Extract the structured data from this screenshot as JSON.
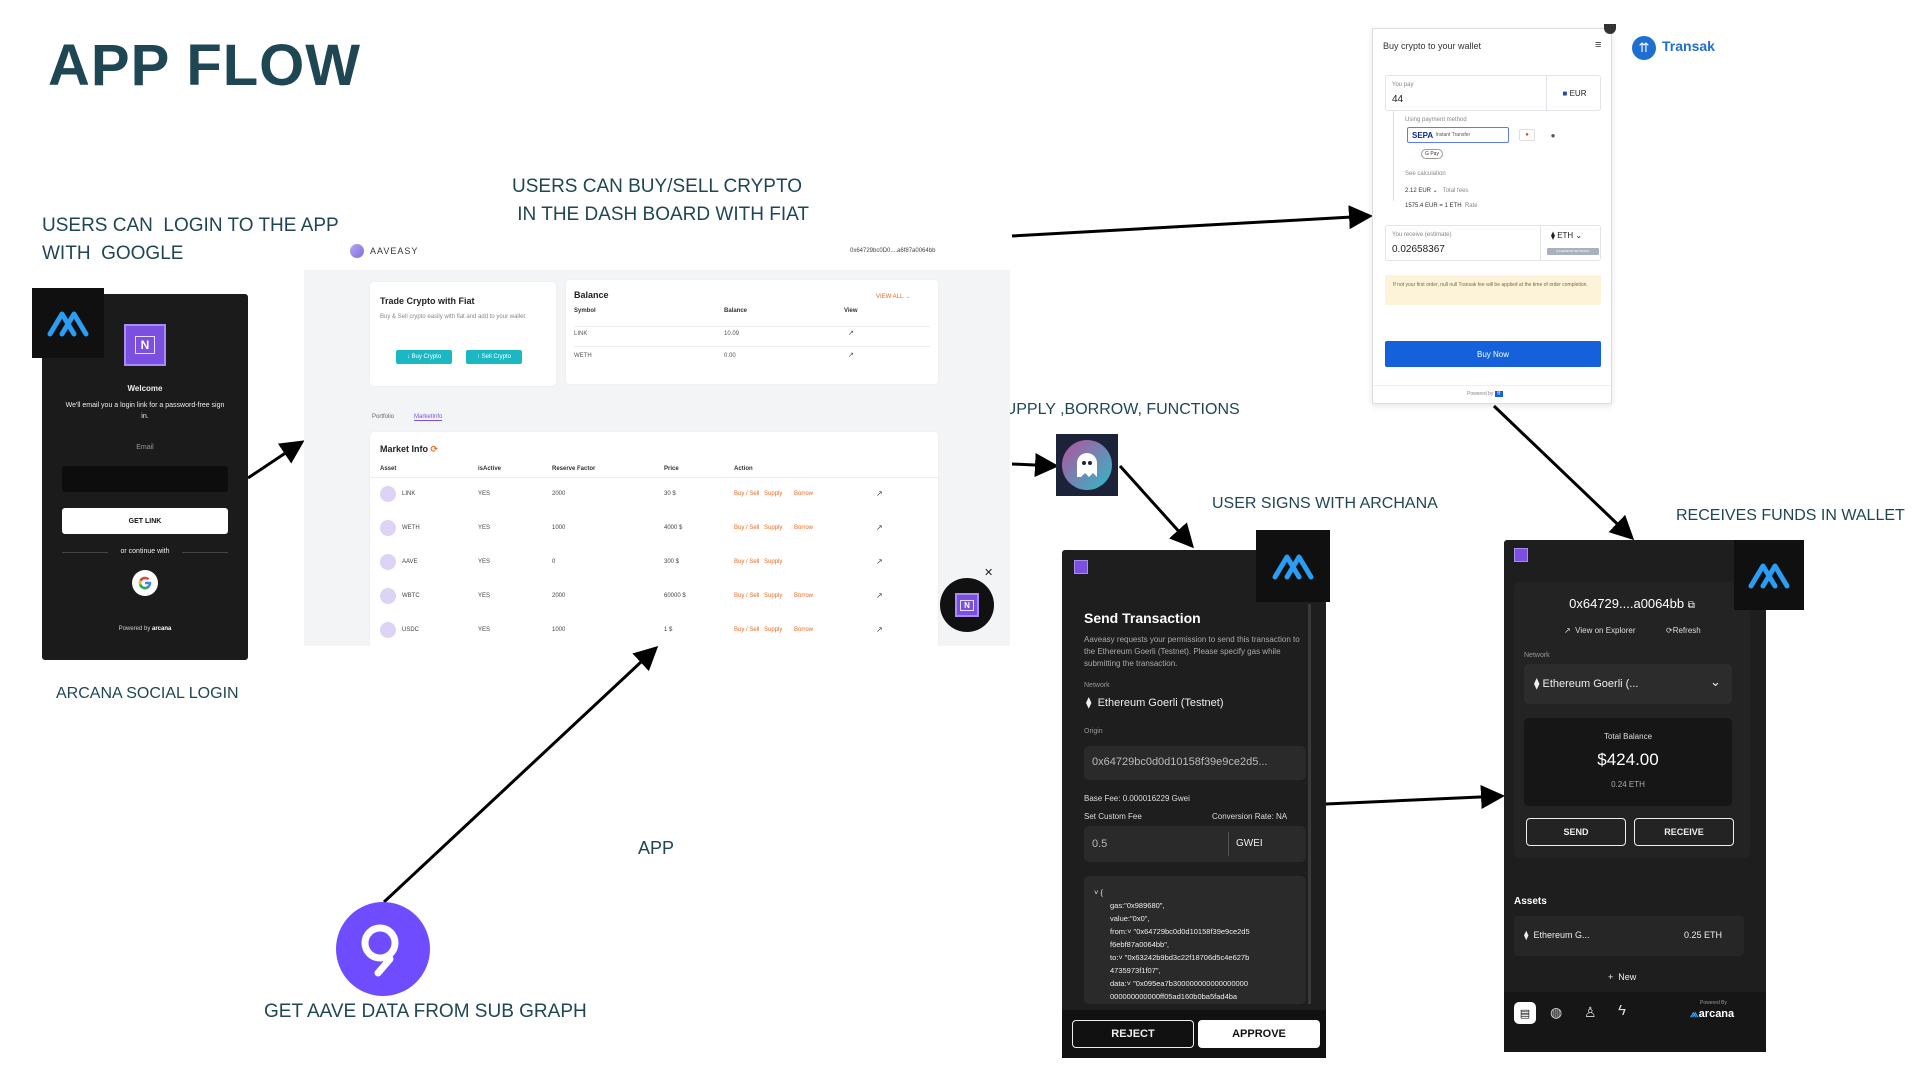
{
  "title": "APP FLOW",
  "labels": {
    "login": "USERS CAN  LOGIN TO THE APP\nWITH  GOOGLE",
    "buy_sell": "USERS CAN BUY/SELL CRYPTO\n IN THE DASH BOARD WITH FIAT",
    "supply": "SUPPLY ,BORROW, FUNCTIONS",
    "signs": "USER SIGNS WITH ARCHANA",
    "receives": "RECEIVES FUNDS IN WALLET",
    "arcana_login": "ARCANA SOCIAL LOGIN",
    "app": "APP",
    "subgraph": "GET AAVE  DATA FROM SUB GRAPH"
  },
  "login": {
    "logo_letter": "N",
    "welcome": "Welcome",
    "desc": "We'll email you a login link for a password-free sign in.",
    "email_label": "Email",
    "get_link": "GET LINK",
    "continue": "or continue with",
    "powered": "Powered by",
    "brand": "arcana"
  },
  "dashboard": {
    "brand": "AAVEASY",
    "address": "0x64729bc0D0....a6f87a0064bb",
    "trade_title": "Trade Crypto with Fiat",
    "trade_desc": "Buy & Sell crypto easily with fiat and add to your wallet",
    "buy_btn": "Buy Crypto",
    "sell_btn": "Sell Crypto",
    "balance_title": "Balance",
    "view_all": "VIEW ALL",
    "balance_headers": [
      "Symbol",
      "Balance",
      "View"
    ],
    "balance_rows": [
      {
        "symbol": "LINK",
        "balance": "10.09"
      },
      {
        "symbol": "WETH",
        "balance": "0.00"
      }
    ],
    "tabs": [
      "Portfolio",
      "MarketInfo"
    ],
    "market_title": "Market Info",
    "market_headers": [
      "Asset",
      "isActive",
      "Reserve Factor",
      "Price",
      "Action"
    ],
    "market_rows": [
      {
        "asset": "LINK",
        "active": "YES",
        "rf": "2000",
        "price": "30 $",
        "actions": [
          "Buy / Sell",
          "Supply",
          "Borrow"
        ]
      },
      {
        "asset": "WETH",
        "active": "YES",
        "rf": "1000",
        "price": "4000 $",
        "actions": [
          "Buy / Sell",
          "Supply",
          "Borrow"
        ]
      },
      {
        "asset": "AAVE",
        "active": "YES",
        "rf": "0",
        "price": "300 $",
        "actions": [
          "Buy / Sell",
          "Supply",
          ""
        ]
      },
      {
        "asset": "WBTC",
        "active": "YES",
        "rf": "2000",
        "price": "60000 $",
        "actions": [
          "Buy / Sell",
          "Supply",
          "Borrow"
        ]
      },
      {
        "asset": "USDC",
        "active": "YES",
        "rf": "1000",
        "price": "1 $",
        "actions": [
          "Buy / Sell",
          "Supply",
          "Borrow"
        ]
      }
    ]
  },
  "transak": {
    "header": "Buy crypto to your wallet",
    "brand": "Transak",
    "you_pay": "You pay",
    "pay_value": "44",
    "pay_currency": "EUR",
    "payment_method": "Using payment method",
    "sepa": "SEPA",
    "instant": "Instant Transfer",
    "gpay": "G Pay",
    "see_calc": "See calculation",
    "fees": "2.12 EUR",
    "fees_label": "Total fees",
    "rate": "1575.4 EUR = 1 ETH",
    "rate_label": "Rate",
    "receive_label": "You receive (estimate)",
    "receive_value": "0.02658367",
    "receive_currency": "ETH",
    "network_tag": "ETHEREUM NETWORK",
    "notice": "If not your first order, null null Transak fee will be applied at the time of order completion.",
    "buy_now": "Buy Now",
    "powered": "Powered by"
  },
  "send_tx": {
    "title": "Send Transaction",
    "desc": "Aaveasy requests your permission to send this transaction to the Ethereum Goerli (Testnet). Please specify gas while submitting the transaction.",
    "network_label": "Network",
    "network": "Ethereum Goerli (Testnet)",
    "origin_label": "Origin",
    "origin": "0x64729bc0d0d10158f39e9ce2d5...",
    "base_fee": "Base Fee: 0.000016229 Gwei",
    "custom_fee": "Set Custom Fee",
    "conversion": "Conversion Rate: NA",
    "fee_value": "0.5",
    "fee_unit": "GWEI",
    "json_lines": [
      "˅ {",
      "gas:\"0x989680\",",
      "value:\"0x0\",",
      "from:˅ \"0x64729bc0d0d10158f39e9ce2d5",
      "f6ebf87a0064bb\",",
      "to:˅ \"0x63242b9bd3c22f18706d5c4e627b",
      "4735973f1f07\",",
      "data:˅ \"0x095ea7b300000000000000000",
      "000000000000ff05ad160b0ba5fad4ba"
    ],
    "reject": "REJECT",
    "approve": "APPROVE"
  },
  "wallet": {
    "address": "0x64729....a0064bb",
    "explorer": "View on Explorer",
    "refresh": "Refresh",
    "network_label": "Network",
    "network": "Ethereum Goerli (...",
    "total_label": "Total Balance",
    "total": "$424.00",
    "total_eth": "0.24 ETH",
    "send": "SEND",
    "receive": "RECEIVE",
    "assets_label": "Assets",
    "asset_name": "Ethereum G...",
    "asset_amount": "0.25 ETH",
    "new": "New",
    "powered": "Powered By",
    "brand": "arcana"
  }
}
